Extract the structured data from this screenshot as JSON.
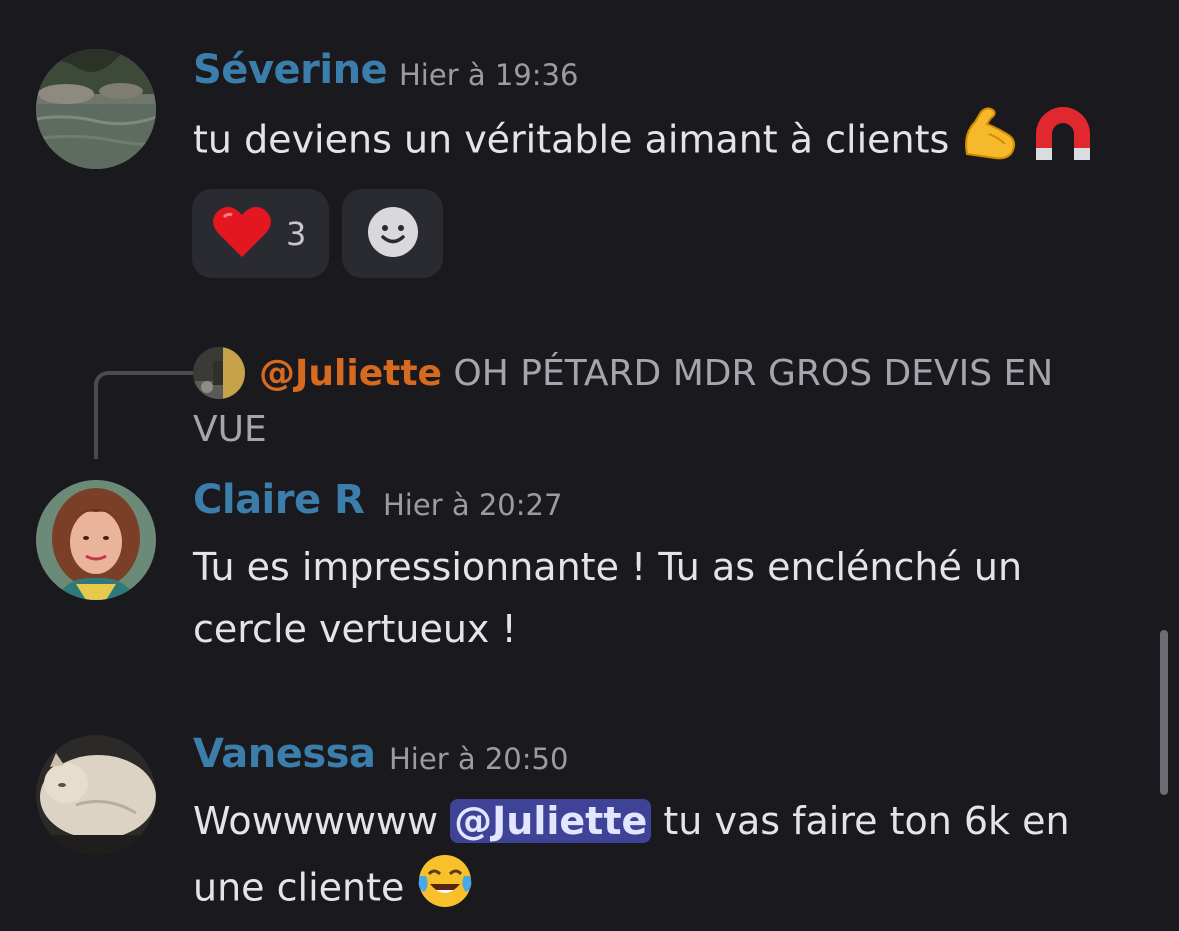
{
  "messages": [
    {
      "author": "Séverine",
      "time": "Hier à 19:36",
      "text": "tu deviens un véritable aimant à clients",
      "emojis": [
        "flexed-biceps",
        "magnet"
      ],
      "reactions": [
        {
          "emoji": "red-heart",
          "count": "3"
        },
        {
          "emoji": "add-reaction"
        }
      ]
    },
    {
      "reply": {
        "mention": "@Juliette",
        "text": "OH PÉTARD MDR GROS DEVIS EN VUE"
      },
      "author": "Claire R",
      "time": "Hier à 20:27",
      "line1": "Tu es impressionnante ! Tu as enclénché un",
      "line2": "cercle vertueux !"
    },
    {
      "author": "Vanessa",
      "time": "Hier à 20:50",
      "prefix": "Wowwwwww",
      "mention": "@Juliette",
      "suffix": "tu vas faire ton 6k en",
      "line2": "une cliente",
      "emojis": [
        "face-with-tears-of-joy"
      ]
    }
  ],
  "colors": {
    "background": "#1a1a1e",
    "author": "#3b7dab",
    "timestamp": "#9b9ba3",
    "text": "#e4e4e8",
    "reply_mention": "#d86a1f",
    "mention_bg": "#3f4398"
  }
}
